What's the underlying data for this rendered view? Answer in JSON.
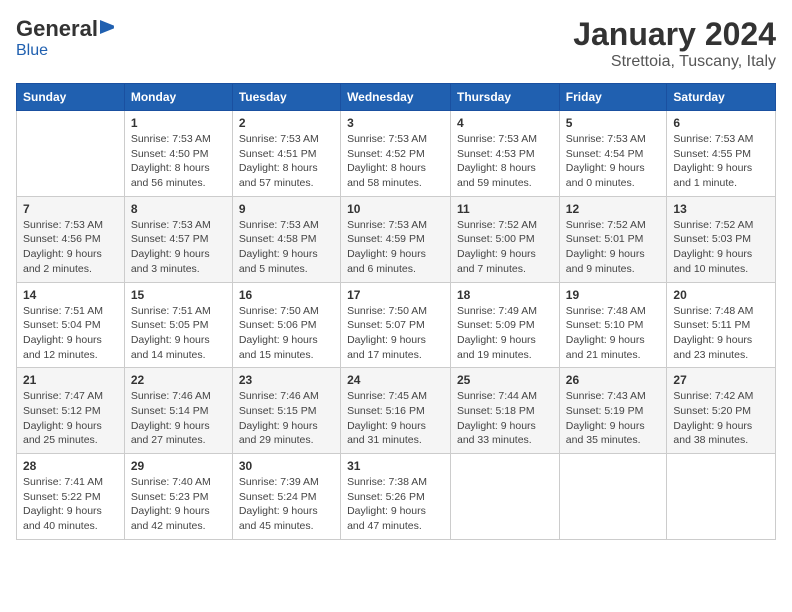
{
  "logo": {
    "general": "General",
    "blue": "Blue"
  },
  "header": {
    "title": "January 2024",
    "subtitle": "Strettoia, Tuscany, Italy"
  },
  "weekdays": [
    "Sunday",
    "Monday",
    "Tuesday",
    "Wednesday",
    "Thursday",
    "Friday",
    "Saturday"
  ],
  "weeks": [
    [
      {
        "day": "",
        "info": ""
      },
      {
        "day": "1",
        "info": "Sunrise: 7:53 AM\nSunset: 4:50 PM\nDaylight: 8 hours\nand 56 minutes."
      },
      {
        "day": "2",
        "info": "Sunrise: 7:53 AM\nSunset: 4:51 PM\nDaylight: 8 hours\nand 57 minutes."
      },
      {
        "day": "3",
        "info": "Sunrise: 7:53 AM\nSunset: 4:52 PM\nDaylight: 8 hours\nand 58 minutes."
      },
      {
        "day": "4",
        "info": "Sunrise: 7:53 AM\nSunset: 4:53 PM\nDaylight: 8 hours\nand 59 minutes."
      },
      {
        "day": "5",
        "info": "Sunrise: 7:53 AM\nSunset: 4:54 PM\nDaylight: 9 hours\nand 0 minutes."
      },
      {
        "day": "6",
        "info": "Sunrise: 7:53 AM\nSunset: 4:55 PM\nDaylight: 9 hours\nand 1 minute."
      }
    ],
    [
      {
        "day": "7",
        "info": "Sunrise: 7:53 AM\nSunset: 4:56 PM\nDaylight: 9 hours\nand 2 minutes."
      },
      {
        "day": "8",
        "info": "Sunrise: 7:53 AM\nSunset: 4:57 PM\nDaylight: 9 hours\nand 3 minutes."
      },
      {
        "day": "9",
        "info": "Sunrise: 7:53 AM\nSunset: 4:58 PM\nDaylight: 9 hours\nand 5 minutes."
      },
      {
        "day": "10",
        "info": "Sunrise: 7:53 AM\nSunset: 4:59 PM\nDaylight: 9 hours\nand 6 minutes."
      },
      {
        "day": "11",
        "info": "Sunrise: 7:52 AM\nSunset: 5:00 PM\nDaylight: 9 hours\nand 7 minutes."
      },
      {
        "day": "12",
        "info": "Sunrise: 7:52 AM\nSunset: 5:01 PM\nDaylight: 9 hours\nand 9 minutes."
      },
      {
        "day": "13",
        "info": "Sunrise: 7:52 AM\nSunset: 5:03 PM\nDaylight: 9 hours\nand 10 minutes."
      }
    ],
    [
      {
        "day": "14",
        "info": "Sunrise: 7:51 AM\nSunset: 5:04 PM\nDaylight: 9 hours\nand 12 minutes."
      },
      {
        "day": "15",
        "info": "Sunrise: 7:51 AM\nSunset: 5:05 PM\nDaylight: 9 hours\nand 14 minutes."
      },
      {
        "day": "16",
        "info": "Sunrise: 7:50 AM\nSunset: 5:06 PM\nDaylight: 9 hours\nand 15 minutes."
      },
      {
        "day": "17",
        "info": "Sunrise: 7:50 AM\nSunset: 5:07 PM\nDaylight: 9 hours\nand 17 minutes."
      },
      {
        "day": "18",
        "info": "Sunrise: 7:49 AM\nSunset: 5:09 PM\nDaylight: 9 hours\nand 19 minutes."
      },
      {
        "day": "19",
        "info": "Sunrise: 7:48 AM\nSunset: 5:10 PM\nDaylight: 9 hours\nand 21 minutes."
      },
      {
        "day": "20",
        "info": "Sunrise: 7:48 AM\nSunset: 5:11 PM\nDaylight: 9 hours\nand 23 minutes."
      }
    ],
    [
      {
        "day": "21",
        "info": "Sunrise: 7:47 AM\nSunset: 5:12 PM\nDaylight: 9 hours\nand 25 minutes."
      },
      {
        "day": "22",
        "info": "Sunrise: 7:46 AM\nSunset: 5:14 PM\nDaylight: 9 hours\nand 27 minutes."
      },
      {
        "day": "23",
        "info": "Sunrise: 7:46 AM\nSunset: 5:15 PM\nDaylight: 9 hours\nand 29 minutes."
      },
      {
        "day": "24",
        "info": "Sunrise: 7:45 AM\nSunset: 5:16 PM\nDaylight: 9 hours\nand 31 minutes."
      },
      {
        "day": "25",
        "info": "Sunrise: 7:44 AM\nSunset: 5:18 PM\nDaylight: 9 hours\nand 33 minutes."
      },
      {
        "day": "26",
        "info": "Sunrise: 7:43 AM\nSunset: 5:19 PM\nDaylight: 9 hours\nand 35 minutes."
      },
      {
        "day": "27",
        "info": "Sunrise: 7:42 AM\nSunset: 5:20 PM\nDaylight: 9 hours\nand 38 minutes."
      }
    ],
    [
      {
        "day": "28",
        "info": "Sunrise: 7:41 AM\nSunset: 5:22 PM\nDaylight: 9 hours\nand 40 minutes."
      },
      {
        "day": "29",
        "info": "Sunrise: 7:40 AM\nSunset: 5:23 PM\nDaylight: 9 hours\nand 42 minutes."
      },
      {
        "day": "30",
        "info": "Sunrise: 7:39 AM\nSunset: 5:24 PM\nDaylight: 9 hours\nand 45 minutes."
      },
      {
        "day": "31",
        "info": "Sunrise: 7:38 AM\nSunset: 5:26 PM\nDaylight: 9 hours\nand 47 minutes."
      },
      {
        "day": "",
        "info": ""
      },
      {
        "day": "",
        "info": ""
      },
      {
        "day": "",
        "info": ""
      }
    ]
  ]
}
